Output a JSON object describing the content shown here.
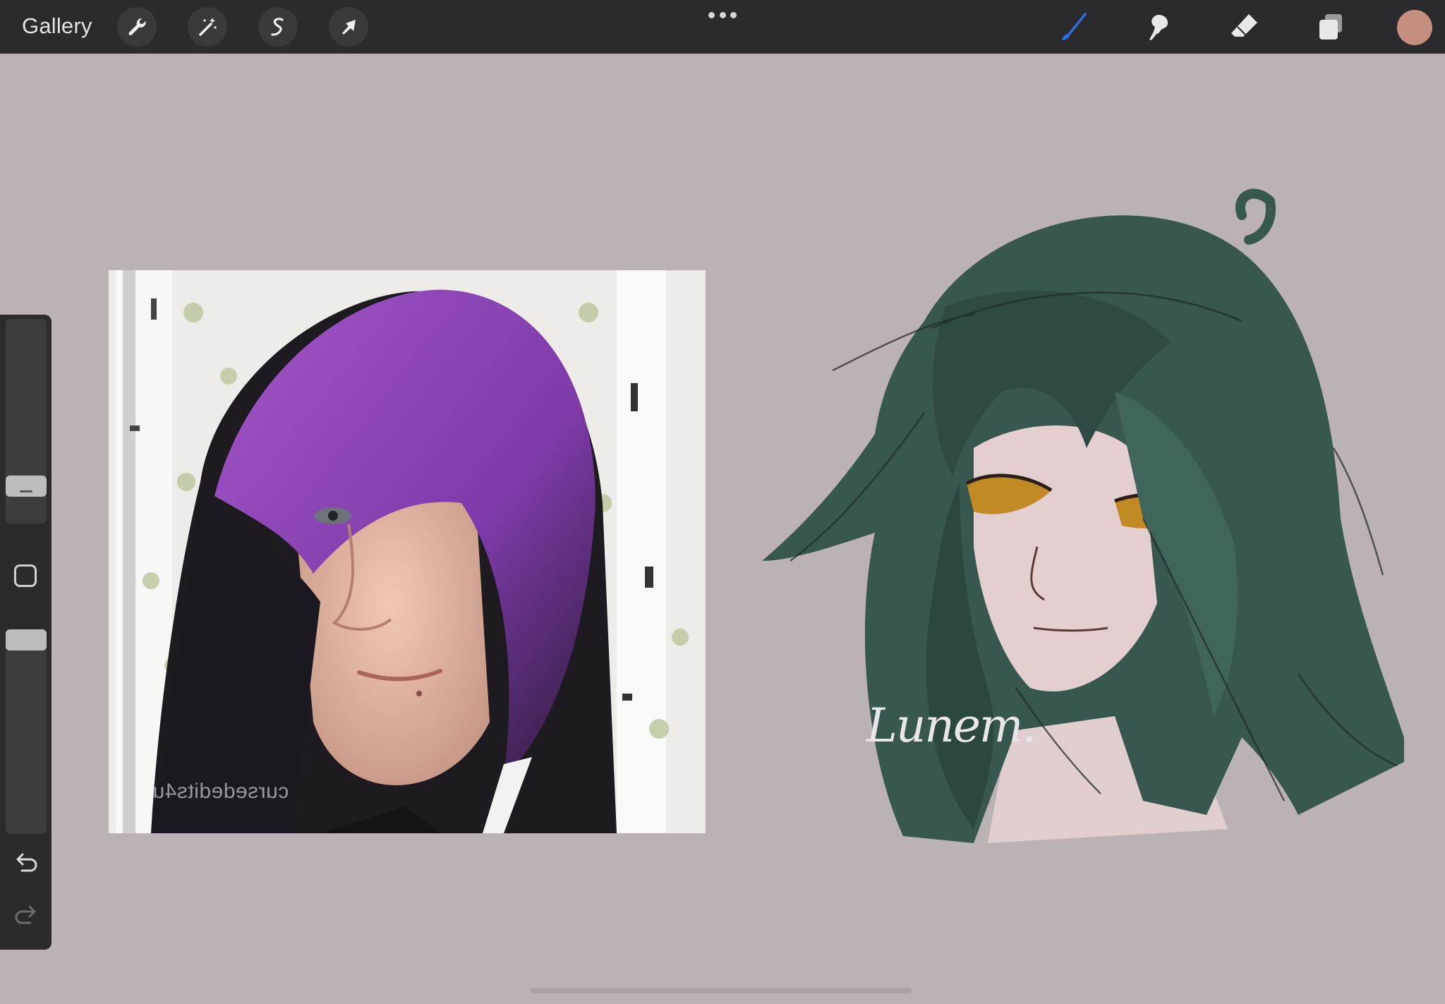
{
  "app": {
    "gallery_label": "Gallery",
    "accent_color": "#2f6fe0",
    "current_color": "#c48f7f"
  },
  "toolbar": {
    "left_tools": [
      "wrench-icon",
      "magic-wand-icon",
      "selection-icon",
      "transform-arrow-icon"
    ],
    "right_tools": [
      "brush-icon",
      "smudge-icon",
      "eraser-icon",
      "layers-icon"
    ],
    "active_tool": "brush"
  },
  "sidebar": {
    "brush_size": 0.2,
    "opacity": 1.0,
    "icons": [
      "modify-square-icon",
      "undo-icon",
      "redo-icon"
    ]
  },
  "canvas": {
    "photo_watermark": "cursededits4u",
    "drawing_signature": "Lunem."
  }
}
